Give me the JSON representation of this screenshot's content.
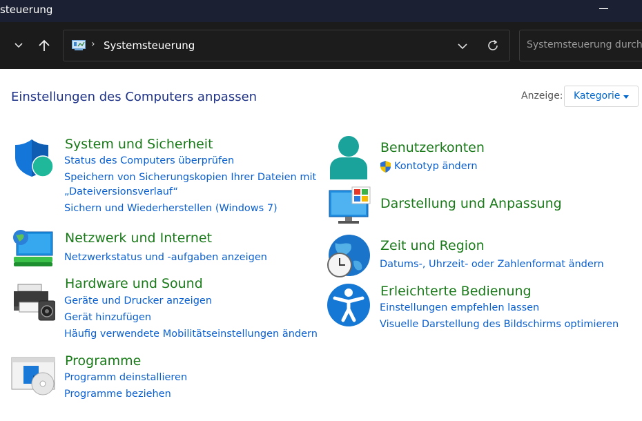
{
  "window": {
    "title": "steuerung"
  },
  "address": {
    "crumb": "Systemsteuerung",
    "separator": "›"
  },
  "search": {
    "placeholder": "Systemsteuerung durchsuchen"
  },
  "page": {
    "heading": "Einstellungen des Computers anpassen"
  },
  "view": {
    "label": "Anzeige:",
    "selected": "Kategorie"
  },
  "categories": {
    "system": {
      "title": "System und Sicherheit",
      "links": [
        "Status des Computers überprüfen",
        "Speichern von Sicherungskopien Ihrer Dateien mit",
        "„Dateiversionsverlauf“",
        "Sichern und Wiederherstellen (Windows 7)"
      ]
    },
    "network": {
      "title": "Netzwerk und Internet",
      "links": [
        "Netzwerkstatus und -aufgaben anzeigen"
      ]
    },
    "hardware": {
      "title": "Hardware und Sound",
      "links": [
        "Geräte und Drucker anzeigen",
        "Gerät hinzufügen",
        "Häufig verwendete Mobilitätseinstellungen ändern"
      ]
    },
    "programs": {
      "title": "Programme",
      "links": [
        "Programm deinstallieren",
        "Programme beziehen"
      ]
    },
    "accounts": {
      "title": "Benutzerkonten",
      "links": [
        "Kontotyp ändern"
      ]
    },
    "appearance": {
      "title": "Darstellung und Anpassung",
      "links": []
    },
    "region": {
      "title": "Zeit und Region",
      "links": [
        "Datums-, Uhrzeit- oder Zahlenformat ändern"
      ]
    },
    "access": {
      "title": "Erleichterte Bedienung",
      "links": [
        "Einstellungen empfehlen lassen",
        "Visuelle Darstellung des Bildschirms optimieren"
      ]
    }
  },
  "colors": {
    "title_bar": "#1b2133",
    "nav_bar": "#1b1b1b",
    "heading": "#1e3287",
    "category": "#1a7a1a",
    "link": "#0a5fcf"
  }
}
